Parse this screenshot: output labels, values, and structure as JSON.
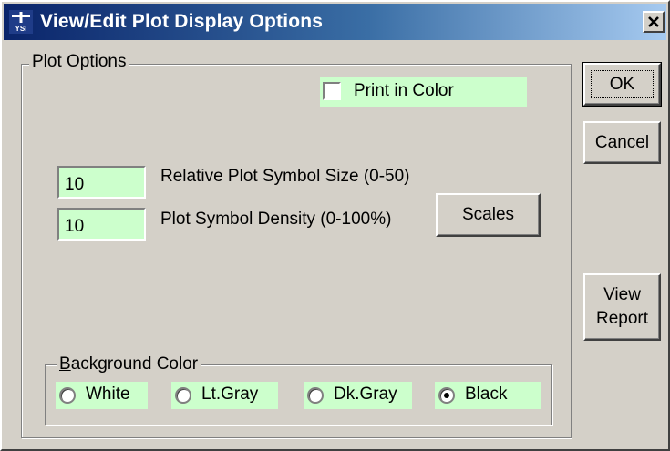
{
  "window": {
    "title": "View/Edit Plot Display Options",
    "close_label": "✕"
  },
  "plot_options": {
    "group_label": "Plot Options",
    "print_in_color": {
      "label": "Print in Color",
      "checked": false
    },
    "symbol_size": {
      "value": "10",
      "label": "Relative Plot Symbol Size (0-50)"
    },
    "symbol_density": {
      "value": "10",
      "label": "Plot Symbol Density (0-100%)"
    },
    "scales_label": "Scales",
    "background_color": {
      "group_label_accel": "B",
      "group_label_rest": "ackground Color",
      "options": [
        {
          "label": "White",
          "selected": false
        },
        {
          "label": "Lt.Gray",
          "selected": false
        },
        {
          "label": "Dk.Gray",
          "selected": false
        },
        {
          "label": "Black",
          "selected": true
        }
      ]
    }
  },
  "buttons": {
    "ok": "OK",
    "cancel": "Cancel",
    "view_report_line1": "View",
    "view_report_line2": "Report"
  },
  "colors": {
    "field_highlight": "#ccffcc",
    "dialog_face": "#d4d0c8",
    "title_gradient_start": "#0a246a",
    "title_gradient_end": "#a6caf0"
  }
}
